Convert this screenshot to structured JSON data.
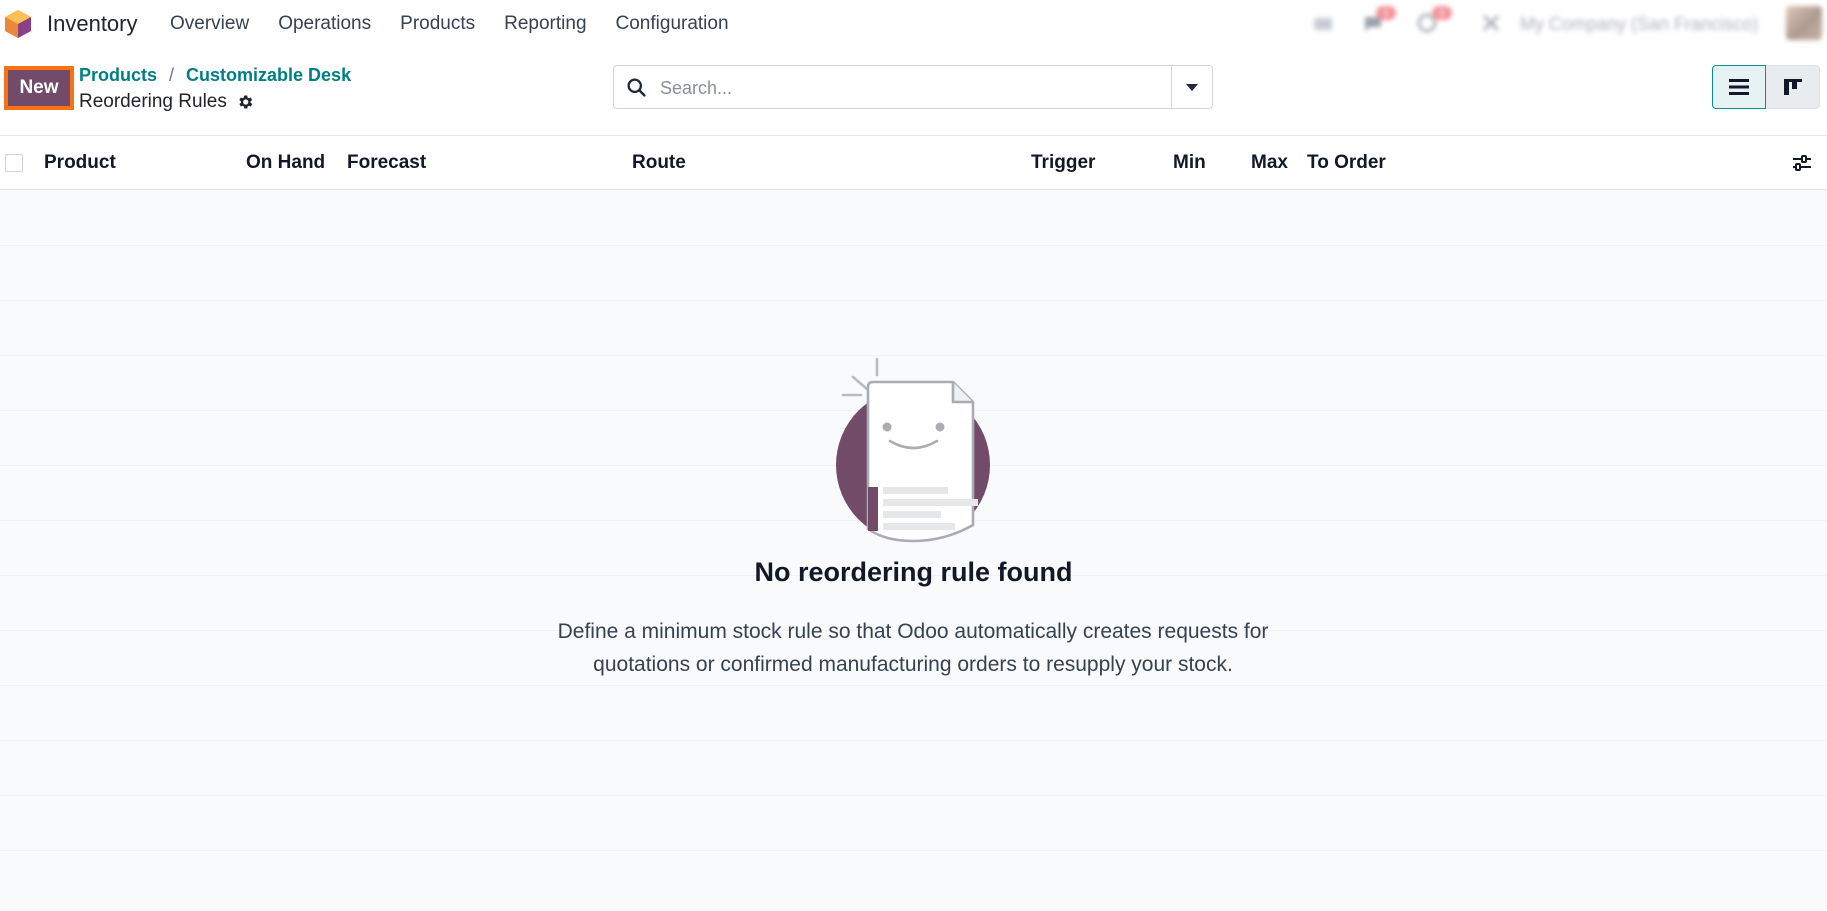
{
  "app": {
    "name": "Inventory",
    "menu": [
      "Overview",
      "Operations",
      "Products",
      "Reporting",
      "Configuration"
    ],
    "brand_color": "#714b67",
    "accent_color": "#017e84"
  },
  "systray": {
    "messages_count": "5",
    "activities_count": "8",
    "company": "My Company (San Francisco)"
  },
  "controlbar": {
    "new_label": "New",
    "breadcrumb": [
      "Products",
      "Customizable Desk"
    ],
    "breadcrumb_separator": "/",
    "title": "Reordering Rules",
    "search_placeholder": "Search..."
  },
  "list": {
    "columns": [
      "Product",
      "On Hand",
      "Forecast",
      "Route",
      "Trigger",
      "Min",
      "Max",
      "To Order"
    ]
  },
  "empty_state": {
    "title": "No reordering rule found",
    "description_line1": "Define a minimum stock rule so that Odoo automatically creates requests for",
    "description_line2": "quotations or confirmed manufacturing orders to resupply your stock."
  },
  "icons": [
    "app-logo-icon",
    "search-icon",
    "chevron-down-icon",
    "gear-icon",
    "list-view-icon",
    "kanban-view-icon",
    "optional-columns-icon"
  ]
}
